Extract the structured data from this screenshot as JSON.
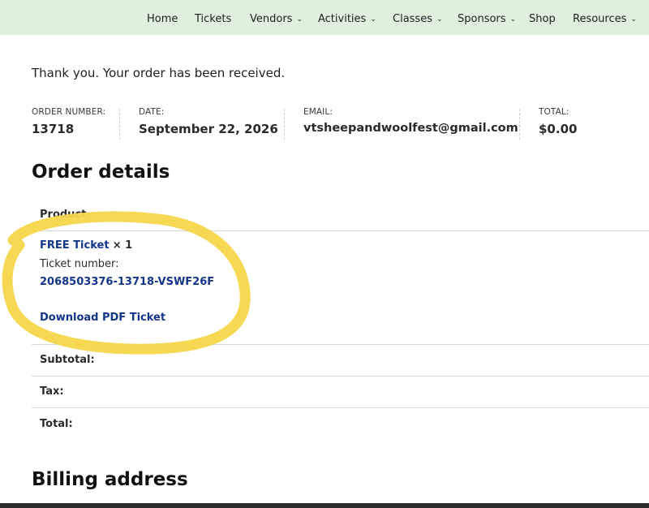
{
  "nav": {
    "items": [
      {
        "label": "Home",
        "dropdown": false
      },
      {
        "label": "Tickets",
        "dropdown": false
      },
      {
        "label": "Vendors",
        "dropdown": true
      },
      {
        "label": "Activities",
        "dropdown": true
      },
      {
        "label": "Classes",
        "dropdown": true
      },
      {
        "label": "Sponsors",
        "dropdown": true
      },
      {
        "label": "Shop",
        "dropdown": false
      },
      {
        "label": "Resources",
        "dropdown": true
      }
    ]
  },
  "message": "Thank you. Your order has been received.",
  "overview": {
    "order_number_label": "ORDER NUMBER:",
    "order_number": "13718",
    "date_label": "DATE:",
    "date": "September 22, 2026",
    "email_label": "EMAIL:",
    "email": "vtsheepandwoolfest@gmail.com",
    "total_label": "TOTAL:",
    "total": "$0.00"
  },
  "order_details": {
    "heading": "Order details",
    "product_header": "Product",
    "item_name": "FREE Ticket",
    "item_qty": "× 1",
    "ticket_number_label": "Ticket number:",
    "ticket_number": "2068503376-13718-VSWF26F",
    "download_label": "Download PDF Ticket",
    "subtotal_label": "Subtotal:",
    "tax_label": "Tax:",
    "total_label": "Total:"
  },
  "billing": {
    "heading": "Billing address"
  },
  "colors": {
    "nav_bg": "#dff1dc",
    "link": "#13358a",
    "highlighter": "#f5d64a"
  }
}
